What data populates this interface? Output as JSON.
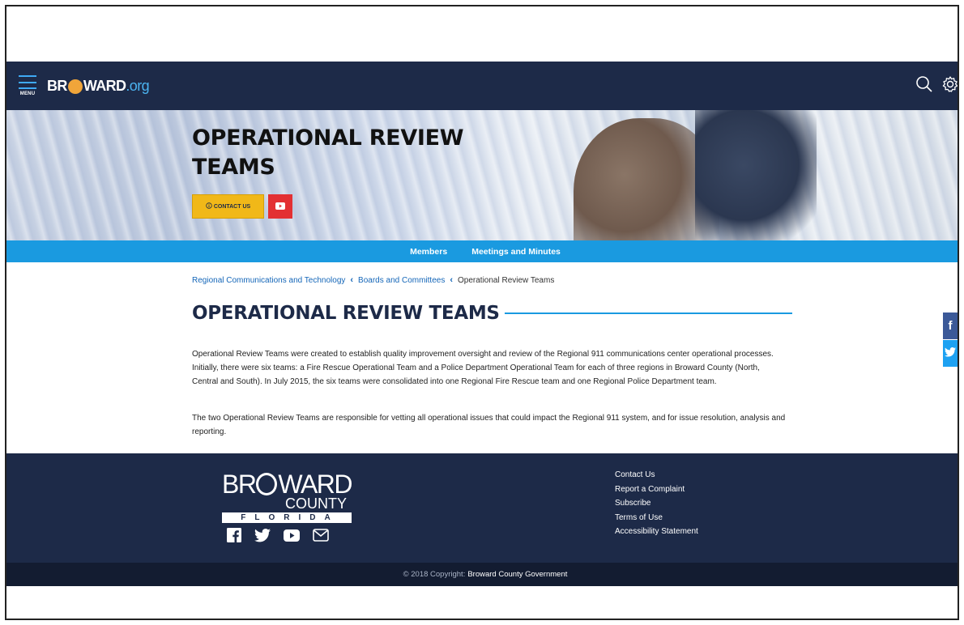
{
  "header": {
    "menu_label": "MENU",
    "brand_part1": "BR",
    "brand_part2": "WARD",
    "brand_suffix": ".org"
  },
  "hero": {
    "title": "OPERATIONAL REVIEW TEAMS",
    "contact_label": "CONTACT US",
    "contact_icon": "info-icon",
    "video_icon": "youtube-icon"
  },
  "subnav": {
    "items": [
      "Members",
      "Meetings and Minutes"
    ]
  },
  "breadcrumb": {
    "items": [
      "Regional Communications and Technology",
      "Boards and Committees"
    ],
    "current": "Operational Review Teams"
  },
  "main": {
    "heading": "OPERATIONAL REVIEW TEAMS",
    "paragraphs": [
      "Operational Review Teams were created to establish quality improvement oversight and review of the Regional 911 communications center operational processes. Initially, there were six teams: a Fire Rescue Operational Team and a Police Department Operational Team for each of three regions in Broward County (North, Central and South). In July 2015, the six teams were consolidated into one Regional Fire Rescue team and one Regional Police Department team.",
      "The two Operational Review Teams are responsible for vetting all operational issues that could impact the Regional 911 system, and for issue resolution, analysis and reporting."
    ]
  },
  "side_social": {
    "facebook_glyph": "f",
    "twitter_glyph": "t"
  },
  "footer": {
    "logo_part1": "BR",
    "logo_part2": "WARD",
    "logo_county": "COUNTY",
    "logo_state": "FLORIDA",
    "links": [
      "Contact Us",
      "Report a Complaint",
      "Subscribe",
      "Terms of Use",
      "Accessibility Statement"
    ],
    "copyright_prefix": "© 2018 Copyright:",
    "copyright_owner": "Broward County Government"
  },
  "colors": {
    "nav_bg": "#1d2a48",
    "accent_blue": "#1a9ae0",
    "contact_yellow": "#f1b818",
    "youtube_red": "#e33033"
  }
}
